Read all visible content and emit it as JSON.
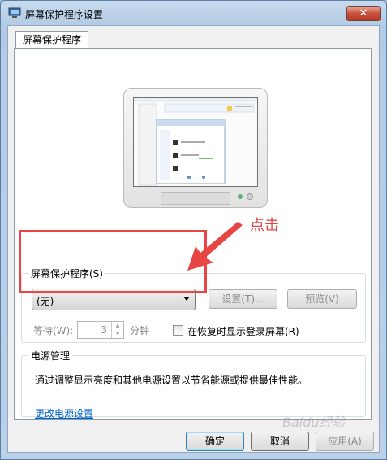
{
  "window": {
    "title": "屏幕保护程序设置",
    "close_label": "✕"
  },
  "tab": {
    "label": "屏幕保护程序"
  },
  "screensaver": {
    "group_label": "屏幕保护程序(S)",
    "selected": "(无)",
    "settings_button": "设置(T)...",
    "preview_button": "预览(V)",
    "wait_label": "等待(W):",
    "wait_value": "3",
    "wait_unit": "分钟",
    "resume_checkbox_label": "在恢复时显示登录屏幕(R)",
    "resume_checked": false
  },
  "power": {
    "group_label": "电源管理",
    "description": "通过调整显示亮度和其他电源设置以节省能源或提供最佳性能。",
    "link_label": "更改电源设置"
  },
  "buttons": {
    "ok": "确定",
    "cancel": "取消",
    "apply": "应用(A)"
  },
  "annotation": {
    "text": "点击",
    "color": "#e84545"
  },
  "watermark": "Baidu经验"
}
